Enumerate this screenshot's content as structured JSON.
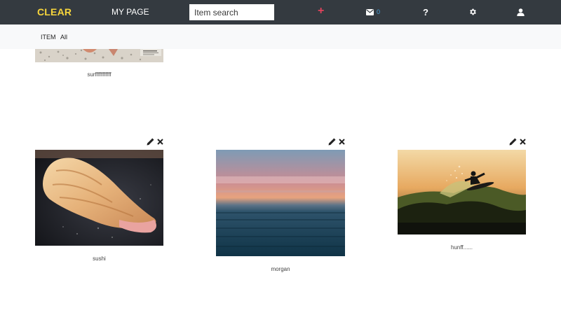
{
  "header": {
    "brand": "CLEAR",
    "mypage_label": "MY PAGE",
    "search_placeholder": "Item search",
    "mail_count": "0"
  },
  "subnav": {
    "section_label": "ITEM",
    "filter_label": "All"
  },
  "items": [
    {
      "caption": "surfffffffffff"
    },
    {
      "caption": "sushi"
    },
    {
      "caption": "morgan"
    },
    {
      "caption": "hunff......"
    }
  ],
  "colors": {
    "topbar": "#343a40",
    "brand": "#f8d63c",
    "add": "#e3435c",
    "badge": "#4aa3df",
    "subbar": "#f8f9fa"
  },
  "icons": [
    "plus-icon",
    "envelope-icon",
    "question-icon",
    "gear-icon",
    "user-icon",
    "pencil-icon",
    "close-icon"
  ]
}
